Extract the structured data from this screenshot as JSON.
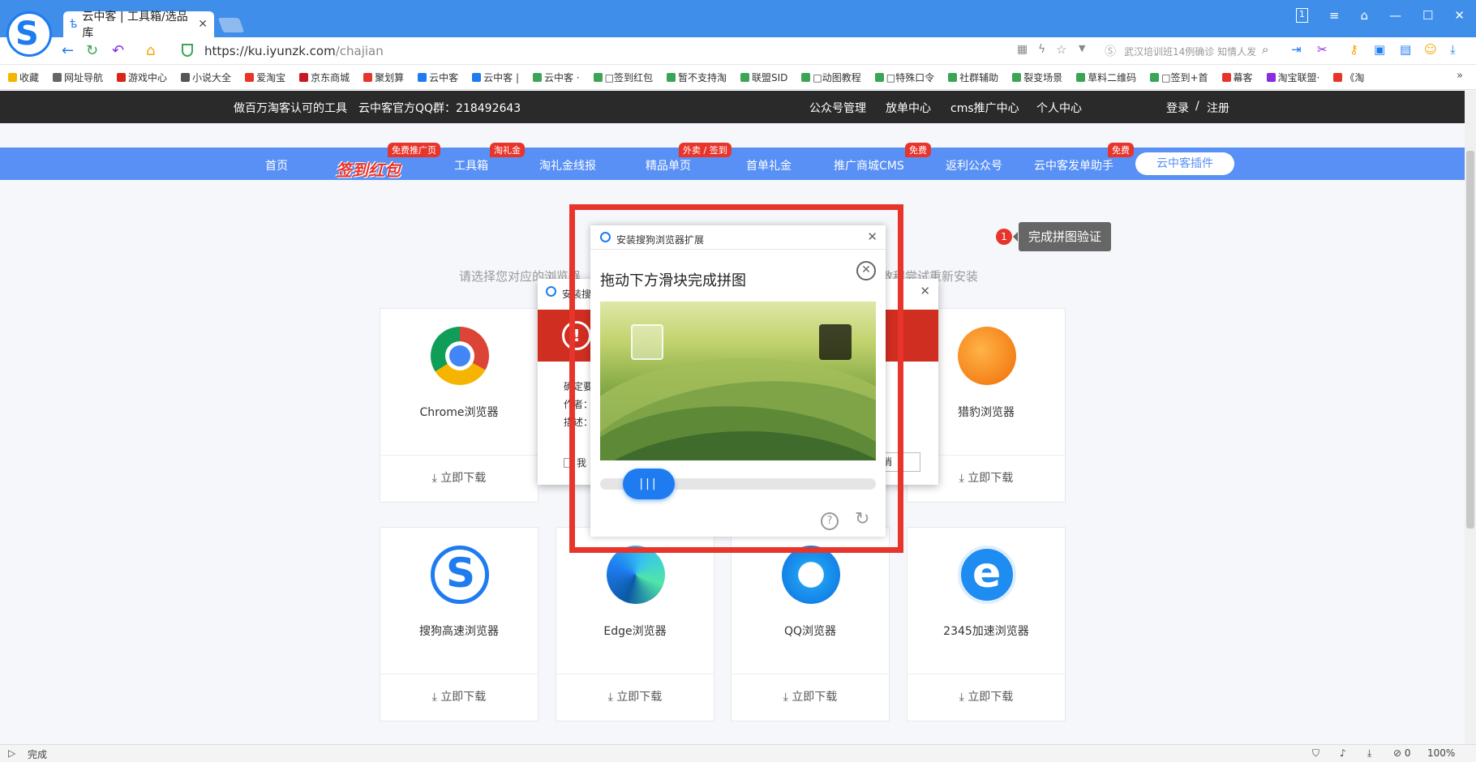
{
  "browser": {
    "tab_title": "云中客 | 工具箱/选品库",
    "tab_close": "✕",
    "url_host": "https://ku.iyunzk.com",
    "url_path": "/chajian",
    "search_ad": "武汉培训班14例确诊 知情人发",
    "window_controls": [
      "1",
      "≡",
      "⌂",
      "—",
      "☐",
      "✕"
    ],
    "bookmarks": [
      {
        "label": "收藏",
        "color": "#f5b400"
      },
      {
        "label": "网址导航",
        "color": "#666"
      },
      {
        "label": "游戏中心",
        "color": "#d9261c"
      },
      {
        "label": "小说大全",
        "color": "#555"
      },
      {
        "label": "爱淘宝",
        "color": "#e8352b"
      },
      {
        "label": "京东商城",
        "color": "#c91623"
      },
      {
        "label": "聚划算",
        "color": "#e8352b"
      },
      {
        "label": "云中客",
        "color": "#1e7cf0"
      },
      {
        "label": "云中客 |",
        "color": "#1e7cf0"
      },
      {
        "label": "云中客 ·",
        "color": "#3aa655"
      },
      {
        "label": "□签到红包",
        "color": "#3aa655"
      },
      {
        "label": "暂不支持淘",
        "color": "#3aa655"
      },
      {
        "label": "联盟SID",
        "color": "#3aa655"
      },
      {
        "label": "□动图教程",
        "color": "#3aa655"
      },
      {
        "label": "□特殊口令",
        "color": "#3aa655"
      },
      {
        "label": "社群辅助",
        "color": "#3aa655"
      },
      {
        "label": "裂变场景",
        "color": "#3aa655"
      },
      {
        "label": "草料二维码",
        "color": "#3aa655"
      },
      {
        "label": "□签到+首",
        "color": "#3aa655"
      },
      {
        "label": "幕客",
        "color": "#e8352b"
      },
      {
        "label": "淘宝联盟·",
        "color": "#8a2be2"
      },
      {
        "label": "《淘",
        "color": "#e8352b"
      }
    ],
    "status_text": "完成",
    "status_right": [
      "⊘ 0",
      "100%"
    ]
  },
  "topbar": {
    "slogan": "做百万淘客认可的工具",
    "qq": "云中客官方QQ群：218492643",
    "links": [
      "公众号管理",
      "放单中心",
      "cms推广中心",
      "个人中心"
    ],
    "login": "登录",
    "sep": "/",
    "register": "注册"
  },
  "nav": {
    "home": "首页",
    "brand": "签到红包",
    "brand_badge": "免费推广页",
    "toolbox": "工具箱",
    "toolbox_badge": "淘礼金",
    "line": "淘礼金线报",
    "single": "精品单页",
    "single_badge": "外卖 / 签到",
    "first": "首单礼金",
    "cms": "推广商城CMS",
    "cms_badge": "免费",
    "rebate": "返利公众号",
    "helper": "云中客发单助手",
    "helper_badge": "免费",
    "plugin": "云中客插件"
  },
  "hint": {
    "left": "请选择您对应的浏览器",
    "right": "教程尝试重新安装"
  },
  "browsers": [
    {
      "name": "Chrome浏览器",
      "download": "立即下载"
    },
    {
      "name": "猎豹浏览器",
      "download": "立即下载"
    },
    {
      "name": "搜狗高速浏览器",
      "download": "立即下载"
    },
    {
      "name": "Edge浏览器",
      "download": "立即下载"
    },
    {
      "name": "QQ浏览器",
      "download": "立即下载"
    },
    {
      "name": "2345加速浏览器",
      "download": "立即下载"
    }
  ],
  "tooltip": {
    "num": "1",
    "text": "完成拼图验证"
  },
  "back_dialog": {
    "title": "安装搜",
    "lines": [
      "确定要",
      "作者：",
      "描述："
    ],
    "check": "我",
    "cancel": "消"
  },
  "captcha": {
    "title": "安装搜狗浏览器扩展",
    "close": "✕",
    "heading": "拖动下方滑块完成拼图",
    "knob": "|||",
    "slider_progress": 0.27
  }
}
